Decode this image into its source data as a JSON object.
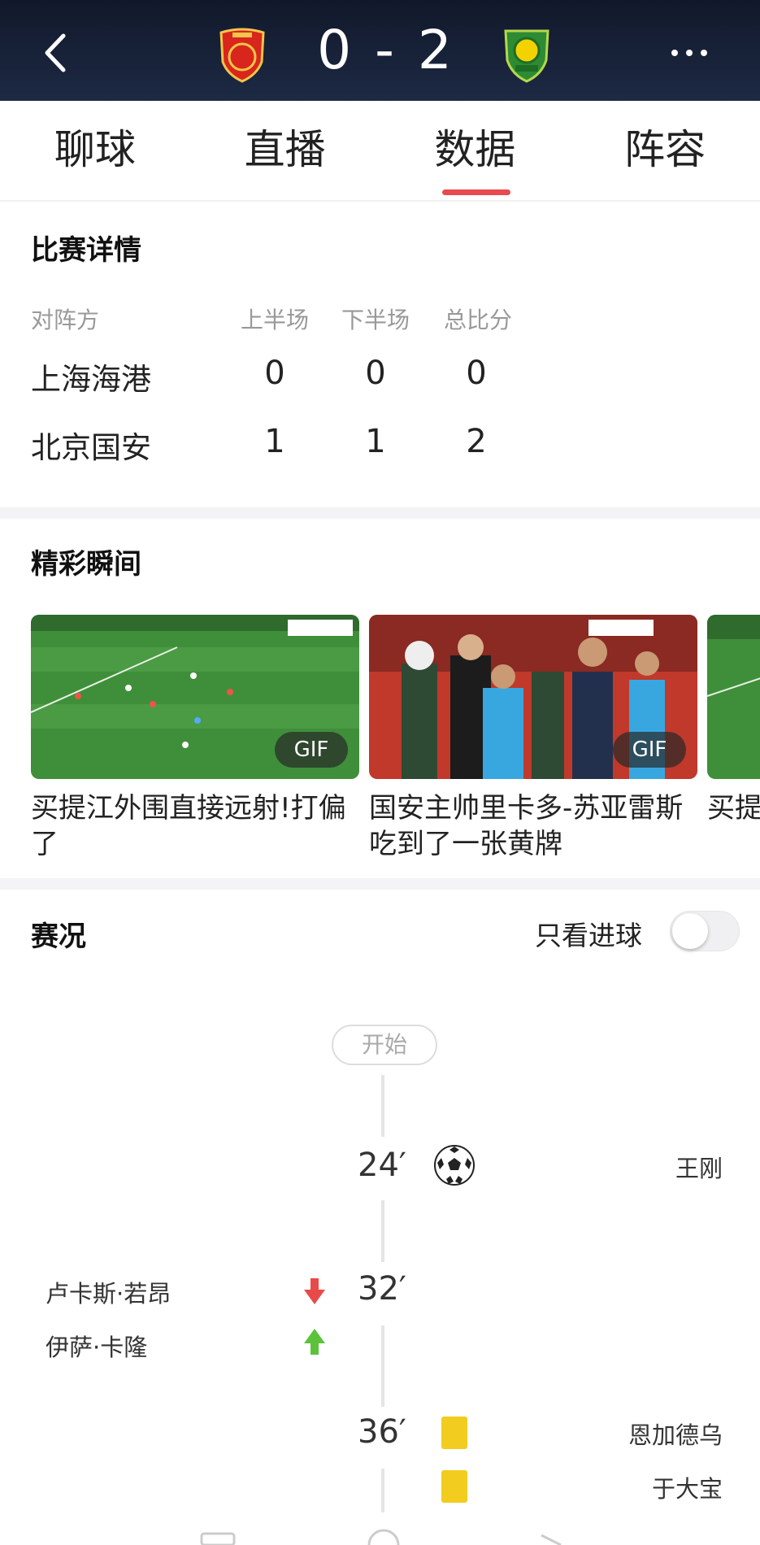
{
  "header": {
    "score": "0 - 2",
    "home_crest": "shanghai-port-crest",
    "away_crest": "beijing-guoan-crest",
    "back_icon": "back-arrow-icon",
    "more_icon": "more-dots-icon"
  },
  "tabs": [
    {
      "label": "聊球"
    },
    {
      "label": "直播"
    },
    {
      "label": "数据",
      "active": true
    },
    {
      "label": "阵容"
    }
  ],
  "details": {
    "title": "比赛详情",
    "headers": [
      "对阵方",
      "上半场",
      "下半场",
      "总比分"
    ],
    "rows": [
      {
        "team": "上海海港",
        "first": "0",
        "second": "0",
        "total": "0"
      },
      {
        "team": "北京国安",
        "first": "1",
        "second": "1",
        "total": "2"
      }
    ]
  },
  "highlights": {
    "title": "精彩瞬间",
    "items": [
      {
        "caption": "买提江外围直接远射!打偏了",
        "badge": "GIF"
      },
      {
        "caption": "国安主帅里卡多-苏亚雷斯吃到了一张黄牌",
        "badge": "GIF"
      },
      {
        "caption": "买提侧，"
      }
    ]
  },
  "events": {
    "title": "赛况",
    "goals_only_label": "只看进球",
    "start_label": "开始",
    "items": [
      {
        "minute": "24′",
        "type": "goal",
        "side": "away",
        "player": "王刚"
      },
      {
        "minute": "32′",
        "type": "substitution",
        "side": "home",
        "player_out": "卢卡斯·若昂",
        "player_in": "伊萨·卡隆"
      },
      {
        "minute": "36′",
        "type": "yellow-card",
        "side": "away",
        "player": "恩加德乌"
      },
      {
        "minute": "",
        "type": "yellow-card",
        "side": "away",
        "player": "于大宝"
      }
    ]
  },
  "colors": {
    "accent": "#e94a4f",
    "header_bg": "#16203a",
    "yellow_card": "#f2cc1f",
    "sub_out": "#e84a4a",
    "sub_in": "#5cc23a"
  }
}
